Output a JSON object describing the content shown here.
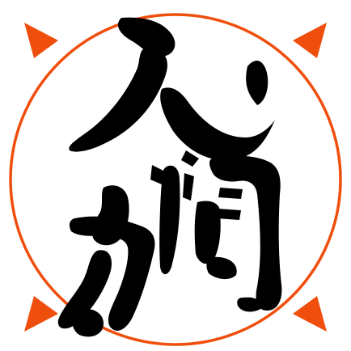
{
  "logo": {
    "text": "人間力",
    "characters": [
      "人",
      "間",
      "力"
    ],
    "colors": {
      "accent": "#f04e0c",
      "ink": "#000000",
      "background": "#ffffff"
    },
    "icons": {
      "ring": "circle-ring",
      "corners": [
        "triangle-marker-top-left",
        "triangle-marker-top-right",
        "triangle-marker-bottom-left",
        "triangle-marker-bottom-right"
      ]
    }
  }
}
